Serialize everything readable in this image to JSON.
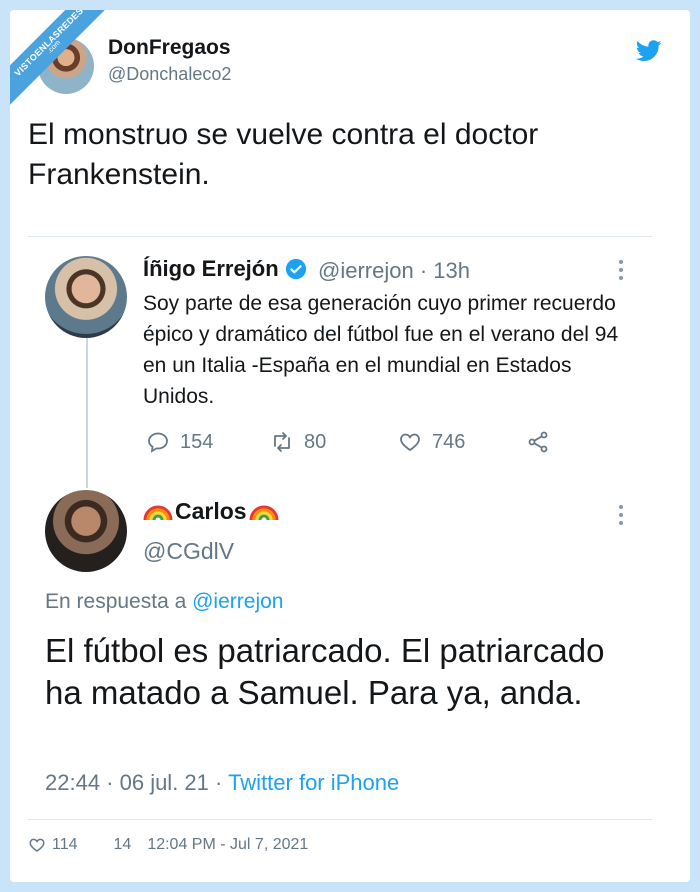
{
  "watermark": {
    "line1": "VISTOENLASREDES",
    "line2": ".com"
  },
  "tweet": {
    "author_name": "DonFregaos",
    "author_handle": "@Donchaleco2",
    "text": "El monstruo se vuelve contra el doctor Frankenstein.",
    "footer": {
      "likes": "114",
      "retweets": "14",
      "timestamp": "12:04 PM - Jul 7, 2021"
    }
  },
  "quoted": {
    "original": {
      "author_name": "Íñigo Errejón",
      "author_handle": "@ierrejon · 13h",
      "text": "Soy parte de esa generación cuyo primer recuerdo épico y dramático del fútbol fue en el verano del 94 en un Italia -España en el mundial en Estados Unidos.",
      "replies": "154",
      "retweets": "80",
      "likes": "746"
    },
    "reply": {
      "author_name": "Carlos",
      "author_handle": "@CGdlV",
      "reply_prefix": "En respuesta a",
      "reply_target": "@ierrejon",
      "text": "El fútbol es patriarcado. El patriarcado ha matado a Samuel. Para ya, anda.",
      "time": "22:44 · 06 jul. 21 ·",
      "client": "Twitter for iPhone"
    }
  },
  "colors": {
    "accent": "#1da1f2",
    "secondary_text": "#657786",
    "background": "#c9e4f8"
  }
}
